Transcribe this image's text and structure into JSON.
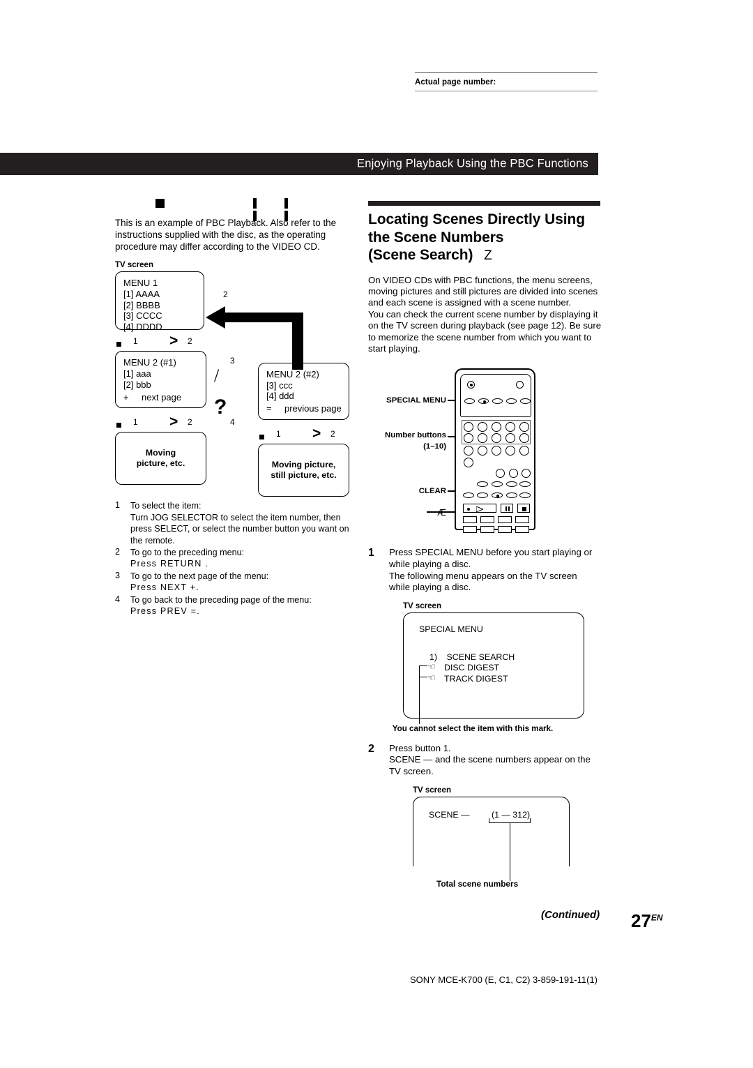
{
  "header": {
    "actual_page_label": "Actual page number:"
  },
  "banner": {
    "title": "Enjoying Playback Using the PBC Functions"
  },
  "left": {
    "icons": {
      "stop": "stop-square-icon",
      "pause_1": "pause-icon",
      "pause_2": "pause-icon"
    },
    "intro": "This is an example of PBC Playback. Also refer to the instructions supplied with the disc, as the operating procedure may differ according to the VIDEO CD.",
    "tv_screen_label": "TV screen",
    "menu1": {
      "title": "MENU 1",
      "items": [
        "[1] AAAA",
        "[2] BBBB",
        "[3] CCCC",
        "[4] DDDD"
      ]
    },
    "arrow_label_2": "2",
    "arrow_label_3": "3",
    "arrow_label_4": "4",
    "connector": {
      "n1": "1",
      "n2": "2",
      "gt": ">"
    },
    "menu2a": {
      "title": "MENU 2 (#1)",
      "items": [
        "[1] aaa",
        "[2] bbb"
      ],
      "page_sign": "+",
      "page_label": "next page"
    },
    "menu2b": {
      "title": "MENU 2 (#2)",
      "items": [
        "[3] ccc",
        "[4] ddd"
      ],
      "page_sign": "=",
      "page_label": "previous page"
    },
    "moving1": {
      "line1": "Moving",
      "line2": "picture, etc."
    },
    "moving2": {
      "line1": "Moving picture,",
      "line2": "still picture, etc."
    },
    "steps": [
      {
        "num": "1",
        "lines": [
          "To select the item:",
          "Turn JOG SELECTOR to select the item number, then",
          "press SELECT, or select the number button you want on",
          "the remote."
        ]
      },
      {
        "num": "2",
        "lines": [
          "To go to the preceding menu:"
        ],
        "command": "Press  RETURN  ."
      },
      {
        "num": "3",
        "lines": [
          "To go to the next page of the menu:"
        ],
        "command": "Press  NEXT +."
      },
      {
        "num": "4",
        "lines": [
          "To go back to the preceding page of the menu:"
        ],
        "command": "Press  PREV =."
      }
    ]
  },
  "right": {
    "heading_line1": "Locating Scenes Directly Using",
    "heading_line2": "the Scene Numbers",
    "heading_line3": "(Scene Search)",
    "heading_mark": "Z",
    "paragraph": "On VIDEO CDs with PBC functions, the menu screens, moving pictures and still pictures are divided into  scenes  and each scene is assigned with a scene number.",
    "paragraph2": "You can check the current scene number by displaying it on the TV screen during playback (see page 12). Be sure to memorize the scene number from which you want to start playing.",
    "remote": {
      "label_special_menu": "SPECIAL MENU",
      "label_number_buttons": "Number buttons",
      "label_number_range": "(1–10)",
      "label_clear": "CLEAR",
      "label_play": "Æ"
    },
    "step1": {
      "num": "1",
      "lines": [
        "Press SPECIAL MENU before you start playing or",
        "while playing a disc.",
        "The following menu appears on the TV screen",
        "while playing a disc."
      ]
    },
    "special_menu_screen": {
      "tv_label": "TV screen",
      "title": "SPECIAL MENU",
      "items": [
        {
          "num": "1)",
          "label": "SCENE SEARCH",
          "disabled": false
        },
        {
          "num": "",
          "label": "DISC DIGEST",
          "disabled": true
        },
        {
          "num": "",
          "label": "TRACK DIGEST",
          "disabled": true
        }
      ],
      "caption": "You cannot select the item with this mark."
    },
    "step2": {
      "num": "2",
      "lines": [
        "Press button 1.",
        " SCENE —  and the scene numbers appear on the",
        "TV screen."
      ]
    },
    "scene_screen": {
      "tv_label": "TV screen",
      "scene_text": "SCENE —",
      "range": "(1 — 312)",
      "caption": "Total scene numbers"
    }
  },
  "footer": {
    "continued": "(Continued)",
    "page_number": "27",
    "page_suffix": "EN",
    "code": "SONY MCE-K700 (E, C1, C2) 3-859-191-11(1)"
  }
}
